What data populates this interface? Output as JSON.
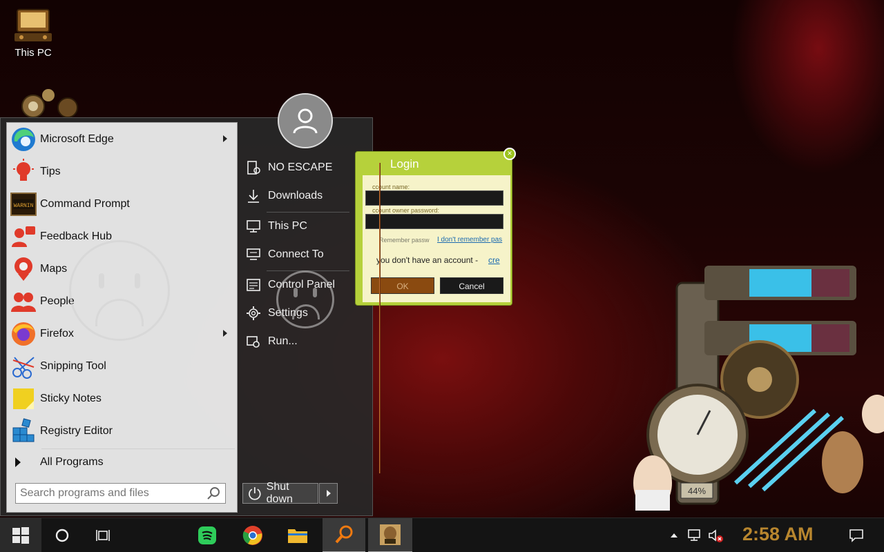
{
  "desktop": {
    "icons": [
      {
        "label": "This PC"
      }
    ]
  },
  "start_menu": {
    "programs": [
      {
        "label": "Microsoft Edge",
        "icon": "edge-icon",
        "has_submenu": true
      },
      {
        "label": "Tips",
        "icon": "lightbulb-icon",
        "has_submenu": false
      },
      {
        "label": "Command Prompt",
        "icon": "command-prompt-icon",
        "has_submenu": false
      },
      {
        "label": "Feedback Hub",
        "icon": "feedback-hub-icon",
        "has_submenu": false
      },
      {
        "label": "Maps",
        "icon": "maps-icon",
        "has_submenu": false
      },
      {
        "label": "People",
        "icon": "people-icon",
        "has_submenu": false
      },
      {
        "label": "Firefox",
        "icon": "firefox-icon",
        "has_submenu": true
      },
      {
        "label": "Snipping Tool",
        "icon": "snipping-tool-icon",
        "has_submenu": false
      },
      {
        "label": "Sticky Notes",
        "icon": "sticky-notes-icon",
        "has_submenu": false
      },
      {
        "label": "Registry Editor",
        "icon": "registry-editor-icon",
        "has_submenu": false
      }
    ],
    "all_programs_label": "All Programs",
    "search_placeholder": "Search programs and files",
    "right_items": [
      {
        "label": "NO ESCAPE",
        "icon": "user-folder-icon"
      },
      {
        "label": "Downloads",
        "icon": "download-icon"
      },
      {
        "label": "This PC",
        "icon": "computer-icon"
      },
      {
        "label": "Connect To",
        "icon": "connect-icon"
      },
      {
        "label": "Control Panel",
        "icon": "control-panel-icon"
      },
      {
        "label": "Settings",
        "icon": "gear-icon"
      },
      {
        "label": "Run...",
        "icon": "run-icon"
      }
    ],
    "shutdown_label": "Shut down"
  },
  "login_dialog": {
    "title": "Login",
    "account_name_label": "ccount name:",
    "password_label": "ccount owner password:",
    "remember_label": "Remember passw",
    "forgot_link": "I don't remember pas",
    "no_account_text": "you don't have an account -",
    "create_link": "cre",
    "ok_label": "OK",
    "cancel_label": "Cancel"
  },
  "taskbar": {
    "clock": "2:58 AM",
    "pinned": [
      "start-button",
      "cortana-button",
      "task-view-button",
      "spotify",
      "chrome",
      "file-explorer",
      "search-app",
      "box-app"
    ]
  },
  "colors": {
    "clock": "#b8862e",
    "login_green": "#b6d13b",
    "start_left_bg": "#f0f0f0",
    "start_right_bg": "#282828"
  }
}
